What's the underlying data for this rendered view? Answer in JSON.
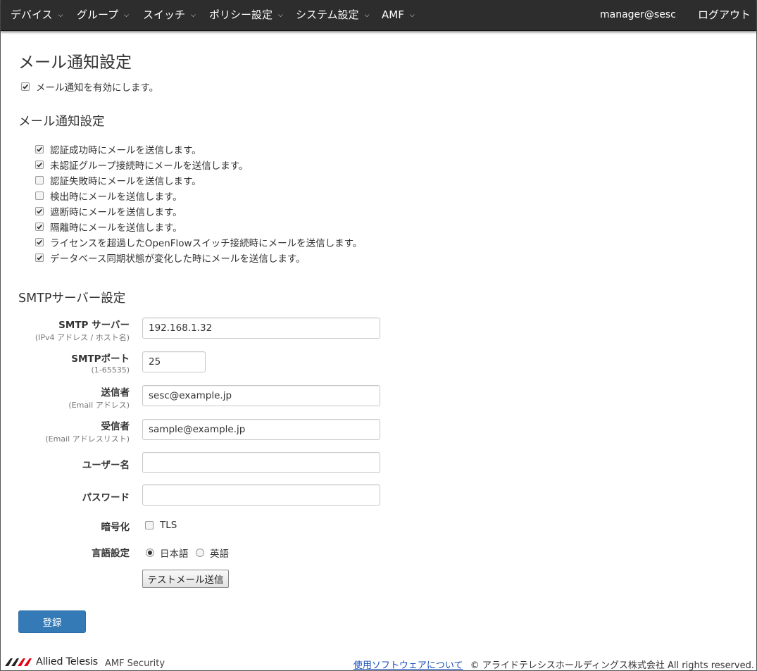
{
  "navbar": {
    "items": [
      {
        "label": "デバイス"
      },
      {
        "label": "グループ"
      },
      {
        "label": "スイッチ"
      },
      {
        "label": "ポリシー設定"
      },
      {
        "label": "システム設定"
      },
      {
        "label": "AMF"
      }
    ],
    "user": "manager@sesc",
    "logout": "ログアウト"
  },
  "page": {
    "title": "メール通知設定",
    "enable": {
      "label": "メール通知を有効にします。",
      "checked": true
    }
  },
  "notify": {
    "heading": "メール通知設定",
    "items": [
      {
        "label": "認証成功時にメールを送信します。",
        "checked": true
      },
      {
        "label": "未認証グループ接続時にメールを送信します。",
        "checked": true
      },
      {
        "label": "認証失敗時にメールを送信します。",
        "checked": false
      },
      {
        "label": "検出時にメールを送信します。",
        "checked": false
      },
      {
        "label": "遮断時にメールを送信します。",
        "checked": true
      },
      {
        "label": "隔離時にメールを送信します。",
        "checked": true
      },
      {
        "label": "ライセンスを超過したOpenFlowスイッチ接続時にメールを送信します。",
        "checked": true
      },
      {
        "label": "データベース同期状態が変化した時にメールを送信します。",
        "checked": true
      }
    ]
  },
  "smtp": {
    "heading": "SMTPサーバー設定",
    "server": {
      "label": "SMTP サーバー",
      "sub": "(IPv4 アドレス / ホスト名)",
      "value": "192.168.1.32"
    },
    "port": {
      "label": "SMTPポート",
      "sub": "(1-65535)",
      "value": "25"
    },
    "from": {
      "label": "送信者",
      "sub": "(Email アドレス)",
      "value": "sesc@example.jp"
    },
    "to": {
      "label": "受信者",
      "sub": "(Email アドレスリスト)",
      "value": "sample@example.jp"
    },
    "username": {
      "label": "ユーザー名",
      "value": ""
    },
    "password": {
      "label": "パスワード",
      "value": ""
    },
    "encryption": {
      "label": "暗号化",
      "option": "TLS",
      "checked": false
    },
    "language": {
      "label": "言語設定",
      "options": [
        "日本語",
        "英語"
      ],
      "selected": "日本語"
    },
    "test_button": "テストメール送信"
  },
  "submit_button": "登録",
  "footer": {
    "brand": "Allied Telesis",
    "product": "AMF Security",
    "link": "使用ソフトウェアについて",
    "copyright": "© アライドテレシスホールディングス株式会社 All rights reserved."
  },
  "colors": {
    "navbar": "#2d2d2d",
    "primary": "#337ab7",
    "link": "#1a4fb8",
    "logo_red": "#e60012"
  }
}
